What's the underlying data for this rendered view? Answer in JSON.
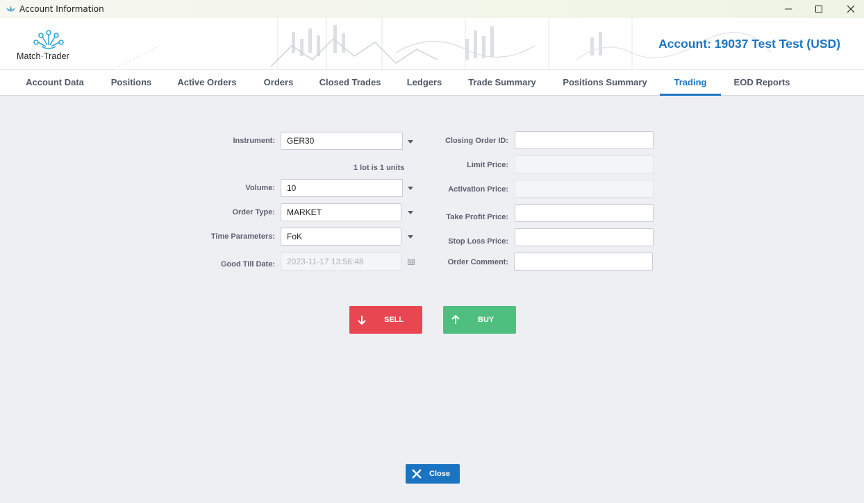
{
  "window": {
    "title": "Account Information",
    "controls": {
      "minimize": "—",
      "maximize": "☐",
      "close": "✕"
    }
  },
  "header": {
    "logo_text": "Match·Trader",
    "account_title": "Account: 19037 Test Test (USD)"
  },
  "tabs": [
    {
      "label": "Account Data"
    },
    {
      "label": "Positions"
    },
    {
      "label": "Active Orders"
    },
    {
      "label": "Orders"
    },
    {
      "label": "Closed Trades"
    },
    {
      "label": "Ledgers"
    },
    {
      "label": "Trade Summary"
    },
    {
      "label": "Positions Summary"
    },
    {
      "label": "Trading",
      "active": true
    },
    {
      "label": "EOD Reports"
    }
  ],
  "form": {
    "instrument": {
      "label": "Instrument:",
      "value": "GER30"
    },
    "lot_note": "1 lot is 1 units",
    "volume": {
      "label": "Volume:",
      "value": "10"
    },
    "order_type": {
      "label": "Order Type:",
      "value": "MARKET"
    },
    "time_parameters": {
      "label": "Time Parameters:",
      "value": "FoK"
    },
    "good_till_date": {
      "label": "Good Till Date:",
      "value": "2023-11-17 13:56:48"
    },
    "closing_order_id": {
      "label": "Closing Order ID:",
      "value": ""
    },
    "limit_price": {
      "label": "Limit Price:",
      "value": ""
    },
    "activation_price": {
      "label": "Activation Price:",
      "value": ""
    },
    "take_profit_price": {
      "label": "Take Profit Price:",
      "value": ""
    },
    "stop_loss_price": {
      "label": "Stop Loss Price:",
      "value": ""
    },
    "order_comment": {
      "label": "Order Comment:",
      "value": ""
    }
  },
  "actions": {
    "sell_label": "SELL",
    "buy_label": "BUY",
    "close_label": "Close"
  },
  "colors": {
    "accent": "#1b74c2",
    "sell": "#e84650",
    "buy": "#4fbf7f",
    "background": "#eeeff3"
  }
}
